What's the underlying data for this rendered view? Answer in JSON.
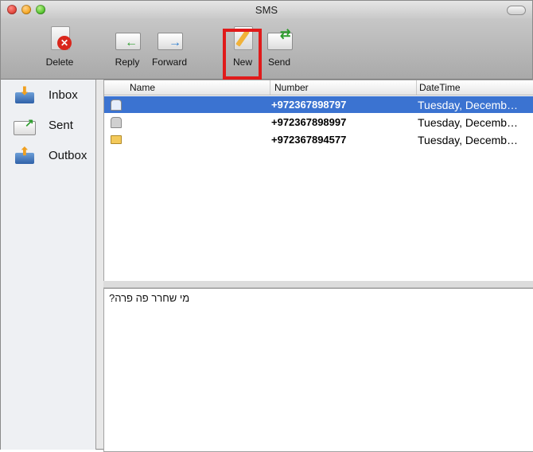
{
  "window": {
    "title": "SMS"
  },
  "toolbar": {
    "delete_label": "Delete",
    "reply_label": "Reply",
    "forward_label": "Forward",
    "new_label": "New",
    "send_label": "Send"
  },
  "sidebar": {
    "items": [
      {
        "label": "Inbox",
        "icon": "inbox-tray-icon"
      },
      {
        "label": "Sent",
        "icon": "sent-envelope-icon"
      },
      {
        "label": "Outbox",
        "icon": "outbox-tray-icon"
      }
    ]
  },
  "table": {
    "columns": [
      "Name",
      "Number",
      "DateTime"
    ],
    "rows": [
      {
        "name": "",
        "number": "+972367898797",
        "datetime": "Tuesday, Decemb…",
        "status_icon": "read-envelope-icon",
        "selected": true
      },
      {
        "name": "",
        "number": "+972367898997",
        "datetime": "Tuesday, Decemb…",
        "status_icon": "read-envelope-icon",
        "selected": false
      },
      {
        "name": "",
        "number": "+972367894577",
        "datetime": "Tuesday, Decemb…",
        "status_icon": "unread-envelope-icon",
        "selected": false
      }
    ]
  },
  "message": {
    "body": "מי שחרר פה פרה?"
  },
  "colors": {
    "selection": "#3b73d1",
    "highlight_box": "#e01a1a"
  }
}
